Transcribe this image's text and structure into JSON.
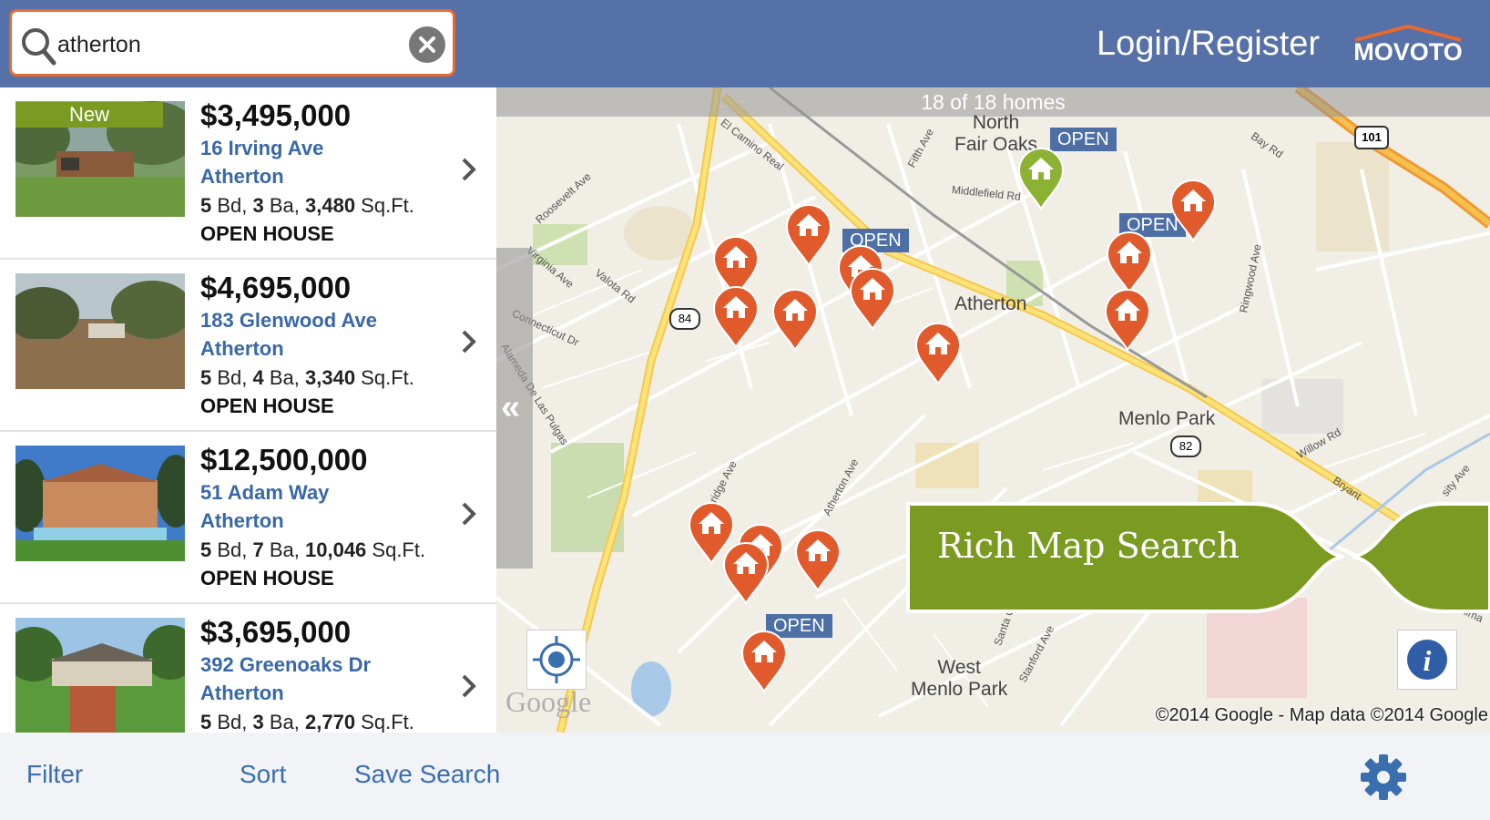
{
  "header": {
    "search_value": "atherton",
    "login_label": "Login/Register",
    "logo_text": "MOVOTO",
    "colors": {
      "header_bg": "#5670a8",
      "search_border": "#e8692e"
    }
  },
  "listings": [
    {
      "badge": "New",
      "price": "$3,495,000",
      "street": "16 Irving Ave",
      "city": "Atherton",
      "beds": "5",
      "beds_unit": " Bd, ",
      "baths": "3",
      "baths_unit": " Ba, ",
      "sqft": "3,480",
      "sqft_unit": " Sq.Ft.",
      "status": "OPEN HOUSE"
    },
    {
      "badge": "",
      "price": "$4,695,000",
      "street": "183 Glenwood Ave",
      "city": "Atherton",
      "beds": "5",
      "beds_unit": " Bd, ",
      "baths": "4",
      "baths_unit": " Ba, ",
      "sqft": "3,340",
      "sqft_unit": " Sq.Ft.",
      "status": "OPEN HOUSE"
    },
    {
      "badge": "",
      "price": "$12,500,000",
      "street": "51 Adam Way",
      "city": "Atherton",
      "beds": "5",
      "beds_unit": " Bd, ",
      "baths": "7",
      "baths_unit": " Ba, ",
      "sqft": "10,046",
      "sqft_unit": " Sq.Ft.",
      "status": "OPEN HOUSE"
    },
    {
      "badge": "",
      "price": "$3,695,000",
      "street": "392 Greenoaks Dr",
      "city": "Atherton",
      "beds": "5",
      "beds_unit": " Bd, ",
      "baths": "3",
      "baths_unit": " Ba, ",
      "sqft": "2,770",
      "sqft_unit": " Sq.Ft.",
      "status": ""
    }
  ],
  "map": {
    "count_text": "18 of 18 homes",
    "collapse_glyph": "«",
    "places": [
      "North\nFair Oaks",
      "Atherton",
      "Menlo Park",
      "West\nMenlo Park"
    ],
    "place_north": "North",
    "place_fair_oaks": "Fair Oaks",
    "place_atherton": "Atherton",
    "place_menlo": "Menlo Park",
    "place_west": "West",
    "place_west_menlo": "Menlo Park",
    "streets": [
      "El Camino Real",
      "Fifth Ave",
      "Middlefield Rd",
      "Bay Rd",
      "Roosevelt Ave",
      "Virginia Ave",
      "Valota Rd",
      "Connecticut Dr",
      "Alameda De Las Pulgas",
      "Ringwood Ave",
      "Willow Rd",
      "Bryant",
      "Stockbridge Ave",
      "Atherton Ave",
      "Santa Cruz Ave",
      "Stanford Ave",
      "Alma",
      "sity Ave",
      "Va"
    ],
    "route_84": "84",
    "route_82": "82",
    "route_101": "101",
    "open_label": "OPEN",
    "google_logo": "Google",
    "copyright": "©2014 Google - Map data ©2014 Google",
    "promo": "Rich Map Search",
    "colors": {
      "pin": "#e05a2b",
      "pin_open": "#8bb233",
      "promo_bg": "#7b9a21",
      "open_tag": "#4d6fa5"
    }
  },
  "bottom_bar": {
    "filter": "Filter",
    "sort": "Sort",
    "save_search": "Save Search"
  }
}
